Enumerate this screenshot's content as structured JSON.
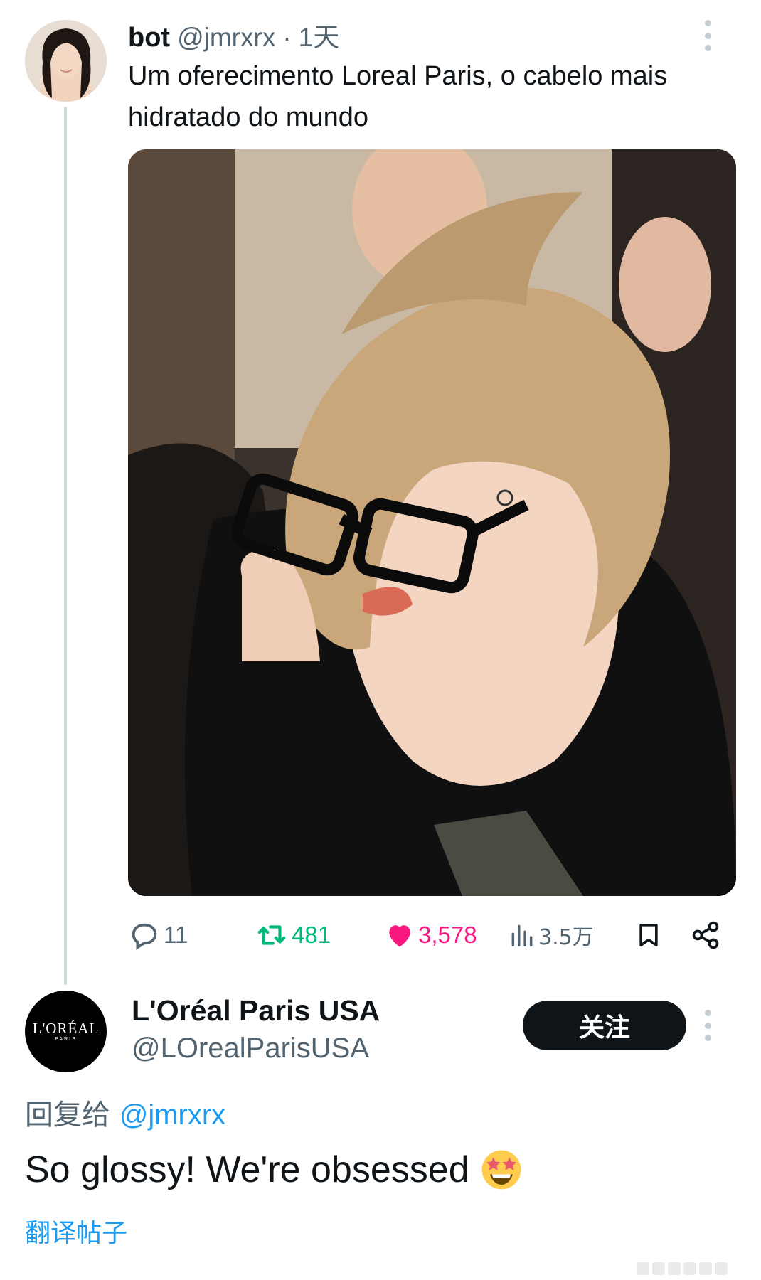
{
  "tweet": {
    "author_name": "bot",
    "handle": "@jmrxrx",
    "separator": "·",
    "time": "1天",
    "text": "Um oferecimento Loreal Paris, o cabelo mais hidratado do mundo",
    "media_alt": "photo",
    "stats": {
      "replies": "11",
      "reposts": "481",
      "likes": "3,578",
      "views": "3.5万"
    },
    "icons": [
      "more-icon",
      "reply-icon",
      "retweet-icon",
      "heart-icon",
      "views-icon",
      "bookmark-icon",
      "share-icon"
    ]
  },
  "reply": {
    "author_name": "L'Oréal Paris USA",
    "handle": "@LOrealParisUSA",
    "avatar_brand": "L'ORÉAL",
    "avatar_sub": "PARIS",
    "follow_label": "关注",
    "replying_to_label": "回复给",
    "replying_to_handle": "@jmrxrx",
    "text": "So glossy! We're obsessed",
    "emoji": "star-struck",
    "translate_label": "翻译帖子"
  },
  "colors": {
    "text": "#0f1419",
    "muted": "#536471",
    "link": "#1d9bf0",
    "retweet": "#00ba7c",
    "like": "#f91880",
    "thread_line": "#cfd9de"
  }
}
